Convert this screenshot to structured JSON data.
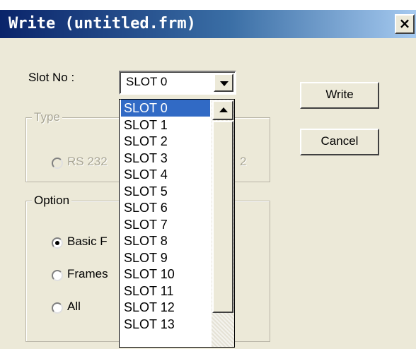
{
  "window": {
    "title": "Write (untitled.frm)",
    "close_glyph": "×"
  },
  "slot": {
    "label": "Slot No :",
    "selected_value": "SLOT 0",
    "options": [
      "SLOT 0",
      "SLOT 1",
      "SLOT 2",
      "SLOT 3",
      "SLOT 4",
      "SLOT 5",
      "SLOT 6",
      "SLOT 7",
      "SLOT 8",
      "SLOT 9",
      "SLOT 10",
      "SLOT 11",
      "SLOT 12",
      "SLOT 13"
    ],
    "selected_index": 0
  },
  "type_group": {
    "title": "Type",
    "radio_label_visible": "RS 232",
    "right_fragment": "2"
  },
  "option_group": {
    "title": "Option",
    "options": [
      {
        "label": "Basic F",
        "checked": true
      },
      {
        "label": "Frames",
        "checked": false
      },
      {
        "label": "All",
        "checked": false
      }
    ]
  },
  "buttons": {
    "write": "Write",
    "cancel": "Cancel"
  },
  "colors": {
    "title_start": "#0a246a",
    "title_end": "#a6caf0",
    "selection": "#316ac5",
    "dialog_bg": "#ece9d8"
  }
}
